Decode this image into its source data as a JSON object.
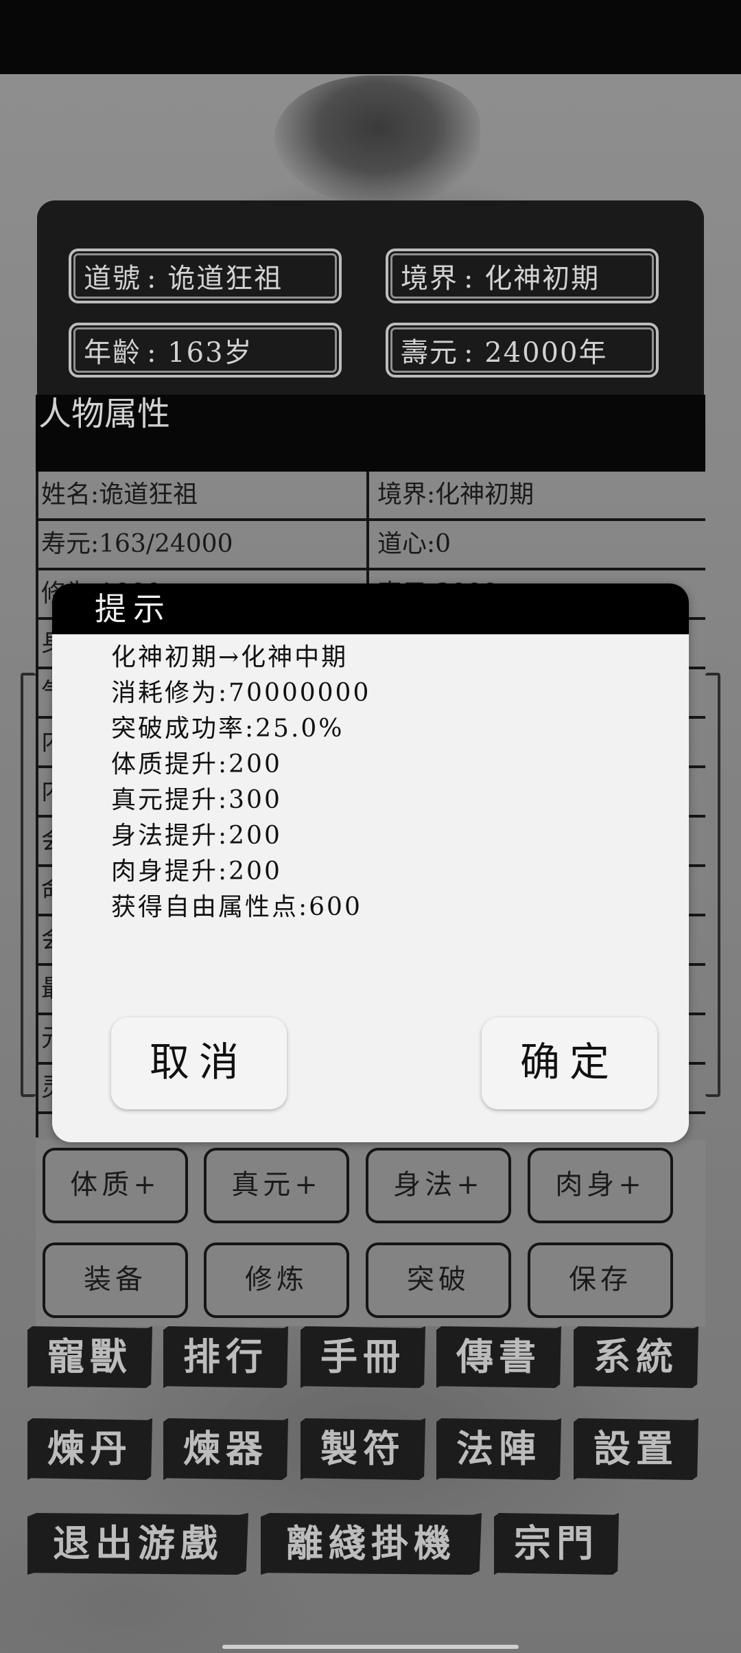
{
  "profile": {
    "dao_label": "道號",
    "dao_value": "诡道狂祖",
    "realm_label": "境界",
    "realm_value": "化神初期",
    "age_label": "年齡",
    "age_value": "163岁",
    "lifespan_label": "壽元",
    "lifespan_value": "24000年"
  },
  "attributes": {
    "title": "人物属性",
    "rows": [
      {
        "left": "姓名:诡道狂祖",
        "right": "境界:化神初期"
      },
      {
        "left": "寿元:163/24000",
        "right": "道心:0"
      },
      {
        "left": "修为:1000",
        "right": "真元:3000"
      },
      {
        "left": "身",
        "right": ""
      },
      {
        "left": "气",
        "right": ""
      },
      {
        "left": "内",
        "right": ""
      },
      {
        "left": "内",
        "right": ""
      },
      {
        "left": "会",
        "right": ""
      },
      {
        "left": "命",
        "right": ""
      },
      {
        "left": "会",
        "right": ""
      },
      {
        "left": "最",
        "right": ""
      },
      {
        "left": "元",
        "right": ""
      },
      {
        "left": "灵",
        "right": ""
      }
    ]
  },
  "actions": {
    "row1": [
      "体质+",
      "真元+",
      "身法+",
      "肉身+"
    ],
    "row2": [
      "装备",
      "修炼",
      "突破",
      "保存"
    ]
  },
  "menu": {
    "row1": [
      "寵獸",
      "排行",
      "手冊",
      "傳書",
      "系統"
    ],
    "row2": [
      "煉丹",
      "煉器",
      "製符",
      "法陣",
      "設置"
    ],
    "row3": [
      "退出游戲",
      "離綫掛機",
      "宗門"
    ]
  },
  "dialog": {
    "title": "提示",
    "lines": [
      "化神初期→化神中期",
      "消耗修为:70000000",
      "突破成功率:25.0%",
      "体质提升:200",
      "真元提升:300",
      "身法提升:200",
      "肉身提升:200",
      "获得自由属性点:600"
    ],
    "cancel_label": "取消",
    "confirm_label": "确定"
  }
}
